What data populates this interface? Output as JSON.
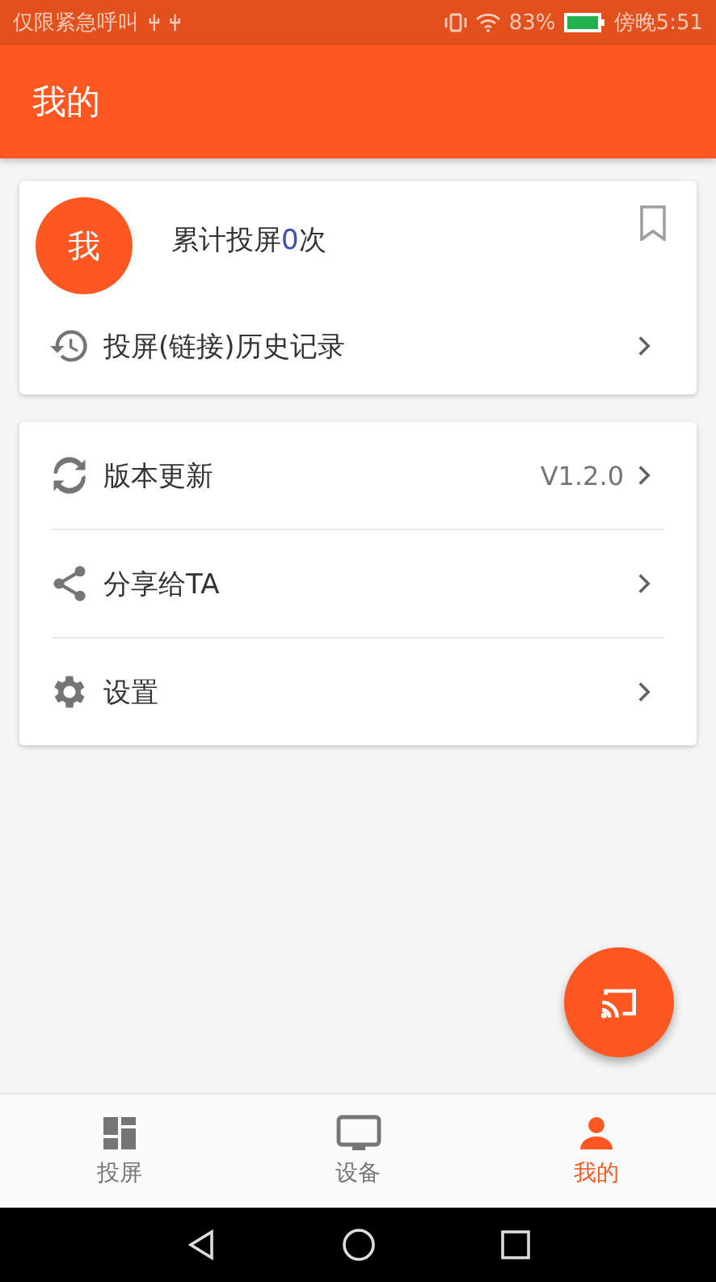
{
  "status_bar": {
    "left_text": "仅限紧急呼叫",
    "battery_percent": "83%",
    "time": "傍晚5:51"
  },
  "app_bar": {
    "title": "我的"
  },
  "profile_card": {
    "avatar_text": "我",
    "count_prefix": "累计投屏",
    "count": "0",
    "count_suffix": "次",
    "history_label": "投屏(链接)历史记录"
  },
  "menu": [
    {
      "kind": "update",
      "label": "版本更新",
      "value": "V1.2.0"
    },
    {
      "kind": "share",
      "label": "分享给TA"
    },
    {
      "kind": "settings",
      "label": "设置"
    }
  ],
  "bottom_nav": [
    {
      "kind": "cast",
      "label": "投屏",
      "selected": false
    },
    {
      "kind": "device",
      "label": "设备",
      "selected": false
    },
    {
      "kind": "me",
      "label": "我的",
      "selected": true
    }
  ]
}
